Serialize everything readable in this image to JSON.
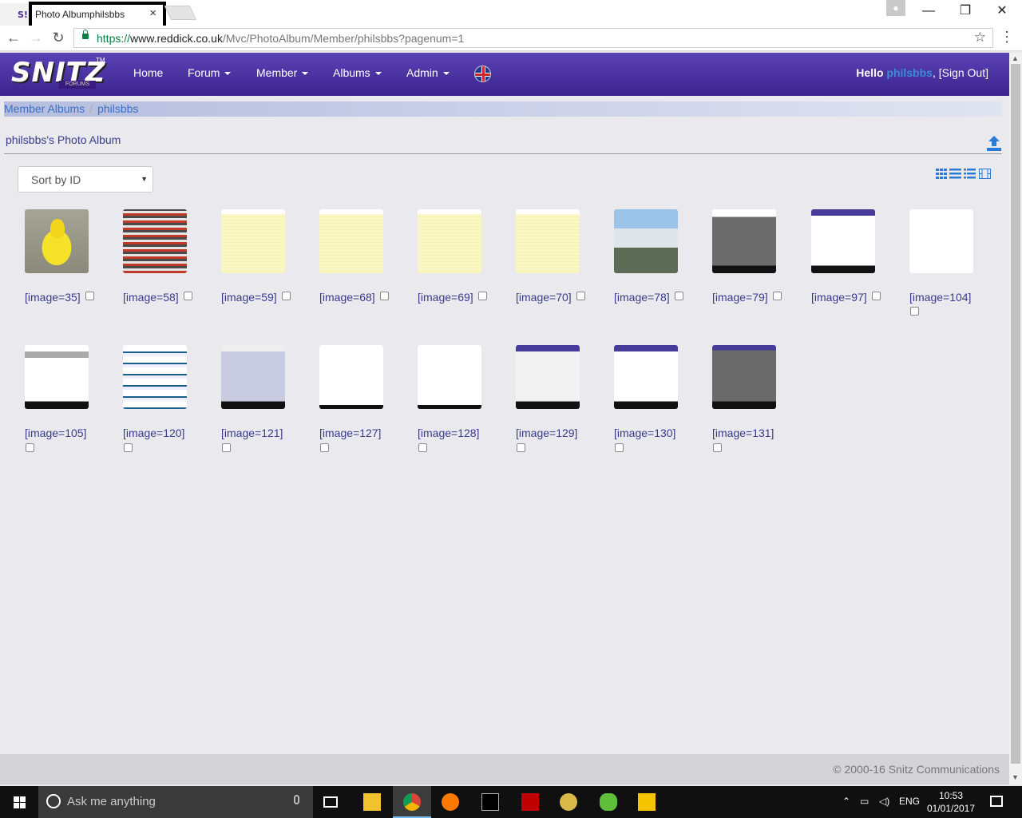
{
  "browser": {
    "tab_ghost_label": "S!",
    "tab_title": "Photo Albumphilsbbs",
    "tab_close": "×",
    "url_scheme": "https://",
    "url_host": "www.reddick.co.uk",
    "url_path": "/Mvc/PhotoAlbum/Member/philsbbs?pagenum=1",
    "window_controls": [
      "—",
      "❐",
      "✕"
    ]
  },
  "site": {
    "logo_text": "SNITZ",
    "logo_sub": "FORUMS",
    "logo_tm": "TM",
    "nav": [
      {
        "label": "Home",
        "dropdown": false
      },
      {
        "label": "Forum",
        "dropdown": true
      },
      {
        "label": "Member",
        "dropdown": true
      },
      {
        "label": "Albums",
        "dropdown": true
      },
      {
        "label": "Admin",
        "dropdown": true
      }
    ],
    "hello_label": "Hello",
    "username": "philsbbs",
    "signout": ", [Sign Out]"
  },
  "breadcrumb": [
    "Member Albums",
    "philsbbs"
  ],
  "breadcrumb_sep": "/",
  "album": {
    "title": "philsbbs's Photo Album",
    "sort_selected": "Sort by ID",
    "images": [
      {
        "label": "[image=35]"
      },
      {
        "label": "[image=58]"
      },
      {
        "label": "[image=59]"
      },
      {
        "label": "[image=68]"
      },
      {
        "label": "[image=69]"
      },
      {
        "label": "[image=70]"
      },
      {
        "label": "[image=78]"
      },
      {
        "label": "[image=79]"
      },
      {
        "label": "[image=97]"
      },
      {
        "label": "[image=104]"
      },
      {
        "label": "[image=105]"
      },
      {
        "label": "[image=120]"
      },
      {
        "label": "[image=121]"
      },
      {
        "label": "[image=127]"
      },
      {
        "label": "[image=128]"
      },
      {
        "label": "[image=129]"
      },
      {
        "label": "[image=130]"
      },
      {
        "label": "[image=131]"
      }
    ]
  },
  "footer": {
    "copyright": "© 2000-16 Snitz Communications"
  },
  "taskbar": {
    "search_placeholder": "Ask me anything",
    "lang": "ENG",
    "time": "10:53",
    "date": "01/01/2017"
  },
  "colors": {
    "navbar": "#4a34a4",
    "link": "#3a6fc4",
    "accent_blue": "#2a7bd5"
  }
}
